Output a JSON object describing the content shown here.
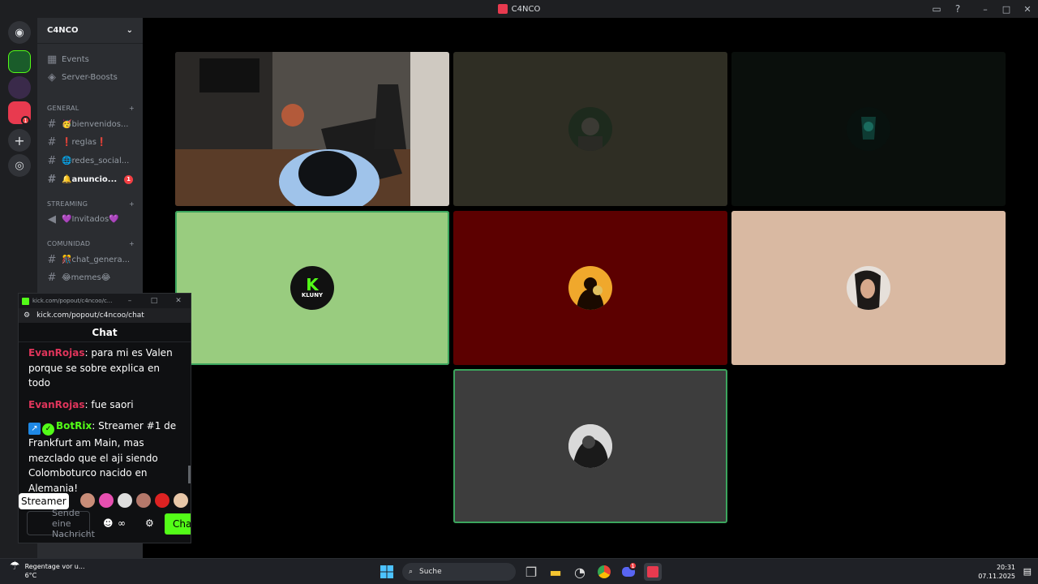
{
  "window": {
    "title": "C4NCO"
  },
  "server": {
    "name": "C4NCO",
    "top_items": [
      {
        "label": "Events",
        "icon": "calendar-icon"
      },
      {
        "label": "Server-Boosts",
        "icon": "boost-icon"
      }
    ],
    "categories": [
      {
        "name": "GENERAL",
        "channels": [
          {
            "label": "🥳bienvenidos...",
            "bold": false
          },
          {
            "label": "❗reglas❗",
            "bold": false
          },
          {
            "label": "🌐redes_social...",
            "bold": false
          },
          {
            "label": "🔔anuncio...",
            "bold": true,
            "unread": "1"
          }
        ]
      },
      {
        "name": "STREAMING",
        "channels": [
          {
            "label": "💜Invitados💜",
            "bold": false,
            "type": "stage"
          }
        ]
      },
      {
        "name": "COMUNIDAD",
        "channels": [
          {
            "label": "🎊chat_genera...",
            "bold": false
          },
          {
            "label": "😂memes😂",
            "bold": false
          }
        ]
      }
    ]
  },
  "guilds": {
    "notification_badge": "1"
  },
  "video_tiles": [
    {
      "kind": "video",
      "bg": "#3c3a36"
    },
    {
      "kind": "avatar",
      "bg": "#2f2e24"
    },
    {
      "kind": "avatar",
      "bg": "#0a0f0c"
    },
    {
      "kind": "avatar",
      "bg": "#99cc7f",
      "speaking": true,
      "avatar_text": "KLUNY"
    },
    {
      "kind": "avatar",
      "bg": "#5c0000"
    },
    {
      "kind": "avatar",
      "bg": "#d9b9a2"
    },
    {
      "kind": "avatar",
      "bg": "#3d3d3d",
      "speaking": true
    }
  ],
  "popout": {
    "window_title": "kick.com/popout/c4ncoo/c...",
    "url": "kick.com/popout/c4ncoo/chat",
    "chat_title": "Chat",
    "messages": [
      {
        "user": "EvanRojas",
        "text": "para mi es Valen porque se sobre explica en todo"
      },
      {
        "user": "EvanRojas",
        "text": "fue saori"
      },
      {
        "user": "BotRix",
        "text": "Streamer #1 de Frankfurt am Main, mas mezclado que el aji siendo Colomboturco nacido en Alemania!"
      }
    ],
    "tooltip": "Streamer",
    "input_placeholder": "Sende eine Nachricht",
    "send_label": "Chat"
  },
  "taskbar": {
    "weather_title": "Regentage vor u...",
    "weather_temp": "6°C",
    "search_placeholder": "Suche",
    "time": "20:31",
    "date": "07.11.2025",
    "discord_badge": "1"
  },
  "colors": {
    "kick_green": "#53fc18",
    "discord_dark": "#1e1f22",
    "speaking": "#3ba55d"
  }
}
